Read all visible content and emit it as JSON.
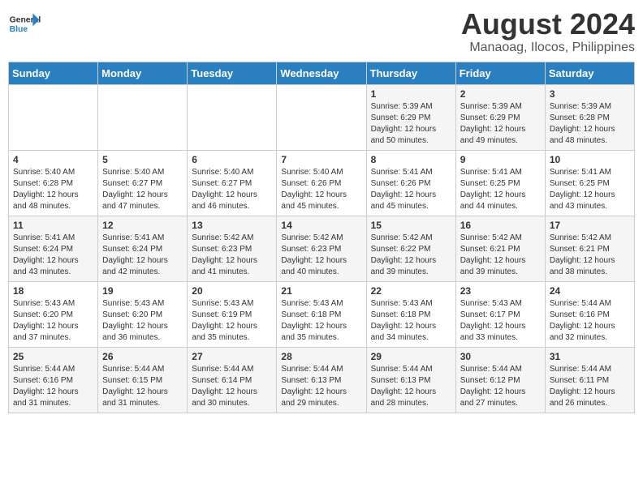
{
  "logo": {
    "general": "General",
    "blue": "Blue"
  },
  "title": "August 2024",
  "subtitle": "Manaoag, Ilocos, Philippines",
  "weekdays": [
    "Sunday",
    "Monday",
    "Tuesday",
    "Wednesday",
    "Thursday",
    "Friday",
    "Saturday"
  ],
  "weeks": [
    [
      {
        "day": "",
        "info": ""
      },
      {
        "day": "",
        "info": ""
      },
      {
        "day": "",
        "info": ""
      },
      {
        "day": "",
        "info": ""
      },
      {
        "day": "1",
        "info": "Sunrise: 5:39 AM\nSunset: 6:29 PM\nDaylight: 12 hours\nand 50 minutes."
      },
      {
        "day": "2",
        "info": "Sunrise: 5:39 AM\nSunset: 6:29 PM\nDaylight: 12 hours\nand 49 minutes."
      },
      {
        "day": "3",
        "info": "Sunrise: 5:39 AM\nSunset: 6:28 PM\nDaylight: 12 hours\nand 48 minutes."
      }
    ],
    [
      {
        "day": "4",
        "info": "Sunrise: 5:40 AM\nSunset: 6:28 PM\nDaylight: 12 hours\nand 48 minutes."
      },
      {
        "day": "5",
        "info": "Sunrise: 5:40 AM\nSunset: 6:27 PM\nDaylight: 12 hours\nand 47 minutes."
      },
      {
        "day": "6",
        "info": "Sunrise: 5:40 AM\nSunset: 6:27 PM\nDaylight: 12 hours\nand 46 minutes."
      },
      {
        "day": "7",
        "info": "Sunrise: 5:40 AM\nSunset: 6:26 PM\nDaylight: 12 hours\nand 45 minutes."
      },
      {
        "day": "8",
        "info": "Sunrise: 5:41 AM\nSunset: 6:26 PM\nDaylight: 12 hours\nand 45 minutes."
      },
      {
        "day": "9",
        "info": "Sunrise: 5:41 AM\nSunset: 6:25 PM\nDaylight: 12 hours\nand 44 minutes."
      },
      {
        "day": "10",
        "info": "Sunrise: 5:41 AM\nSunset: 6:25 PM\nDaylight: 12 hours\nand 43 minutes."
      }
    ],
    [
      {
        "day": "11",
        "info": "Sunrise: 5:41 AM\nSunset: 6:24 PM\nDaylight: 12 hours\nand 43 minutes."
      },
      {
        "day": "12",
        "info": "Sunrise: 5:41 AM\nSunset: 6:24 PM\nDaylight: 12 hours\nand 42 minutes."
      },
      {
        "day": "13",
        "info": "Sunrise: 5:42 AM\nSunset: 6:23 PM\nDaylight: 12 hours\nand 41 minutes."
      },
      {
        "day": "14",
        "info": "Sunrise: 5:42 AM\nSunset: 6:23 PM\nDaylight: 12 hours\nand 40 minutes."
      },
      {
        "day": "15",
        "info": "Sunrise: 5:42 AM\nSunset: 6:22 PM\nDaylight: 12 hours\nand 39 minutes."
      },
      {
        "day": "16",
        "info": "Sunrise: 5:42 AM\nSunset: 6:21 PM\nDaylight: 12 hours\nand 39 minutes."
      },
      {
        "day": "17",
        "info": "Sunrise: 5:42 AM\nSunset: 6:21 PM\nDaylight: 12 hours\nand 38 minutes."
      }
    ],
    [
      {
        "day": "18",
        "info": "Sunrise: 5:43 AM\nSunset: 6:20 PM\nDaylight: 12 hours\nand 37 minutes."
      },
      {
        "day": "19",
        "info": "Sunrise: 5:43 AM\nSunset: 6:20 PM\nDaylight: 12 hours\nand 36 minutes."
      },
      {
        "day": "20",
        "info": "Sunrise: 5:43 AM\nSunset: 6:19 PM\nDaylight: 12 hours\nand 35 minutes."
      },
      {
        "day": "21",
        "info": "Sunrise: 5:43 AM\nSunset: 6:18 PM\nDaylight: 12 hours\nand 35 minutes."
      },
      {
        "day": "22",
        "info": "Sunrise: 5:43 AM\nSunset: 6:18 PM\nDaylight: 12 hours\nand 34 minutes."
      },
      {
        "day": "23",
        "info": "Sunrise: 5:43 AM\nSunset: 6:17 PM\nDaylight: 12 hours\nand 33 minutes."
      },
      {
        "day": "24",
        "info": "Sunrise: 5:44 AM\nSunset: 6:16 PM\nDaylight: 12 hours\nand 32 minutes."
      }
    ],
    [
      {
        "day": "25",
        "info": "Sunrise: 5:44 AM\nSunset: 6:16 PM\nDaylight: 12 hours\nand 31 minutes."
      },
      {
        "day": "26",
        "info": "Sunrise: 5:44 AM\nSunset: 6:15 PM\nDaylight: 12 hours\nand 31 minutes."
      },
      {
        "day": "27",
        "info": "Sunrise: 5:44 AM\nSunset: 6:14 PM\nDaylight: 12 hours\nand 30 minutes."
      },
      {
        "day": "28",
        "info": "Sunrise: 5:44 AM\nSunset: 6:13 PM\nDaylight: 12 hours\nand 29 minutes."
      },
      {
        "day": "29",
        "info": "Sunrise: 5:44 AM\nSunset: 6:13 PM\nDaylight: 12 hours\nand 28 minutes."
      },
      {
        "day": "30",
        "info": "Sunrise: 5:44 AM\nSunset: 6:12 PM\nDaylight: 12 hours\nand 27 minutes."
      },
      {
        "day": "31",
        "info": "Sunrise: 5:44 AM\nSunset: 6:11 PM\nDaylight: 12 hours\nand 26 minutes."
      }
    ]
  ]
}
